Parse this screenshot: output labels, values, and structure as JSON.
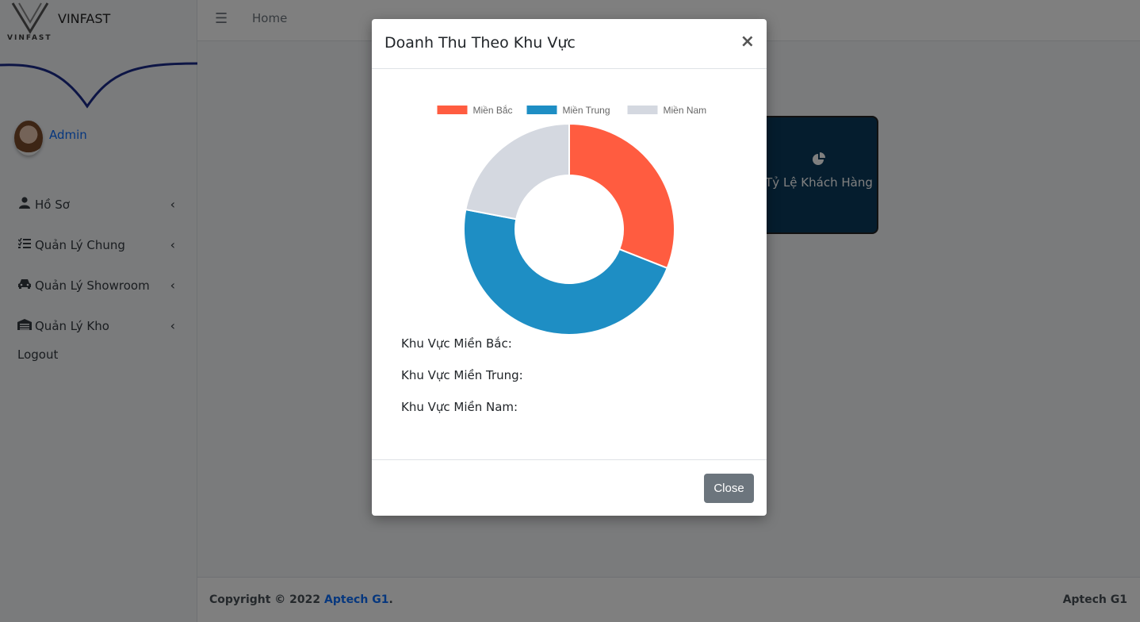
{
  "brand": {
    "title": "VINFAST",
    "logo_word": "VINFAST"
  },
  "user": {
    "name": "Admin"
  },
  "sidebar": {
    "items": [
      {
        "label": "Hồ Sơ",
        "icon": "user-icon"
      },
      {
        "label": "Quản Lý Chung",
        "icon": "list-check-icon"
      },
      {
        "label": "Quản Lý Showroom",
        "icon": "car-icon"
      },
      {
        "label": "Quản Lý Kho",
        "icon": "warehouse-icon"
      }
    ],
    "logout": "Logout"
  },
  "topbar": {
    "home": "Home"
  },
  "card": {
    "label": "Tỷ Lệ Khách Hàng",
    "icon": "pie-chart-icon"
  },
  "footer": {
    "copyright": "Copyright © 2022 ",
    "link": "Aptech G1",
    "period": ".",
    "right": "Aptech G1"
  },
  "modal": {
    "title": "Doanh Thu Theo Khu Vực",
    "close_symbol": "×",
    "regions": [
      "Khu Vực Miền Bắc:",
      "Khu Vực Miền Trung:",
      "Khu Vực Miền Nam:"
    ],
    "close_button": "Close"
  },
  "chart_data": {
    "type": "pie",
    "donut": true,
    "legend_position": "top",
    "labels": [
      "Miền Bắc",
      "Miền Trung",
      "Miền Nam"
    ],
    "values": [
      31,
      47,
      22
    ],
    "colors": [
      "#ff5c40",
      "#1e8ec4",
      "#d4d8e0"
    ]
  }
}
